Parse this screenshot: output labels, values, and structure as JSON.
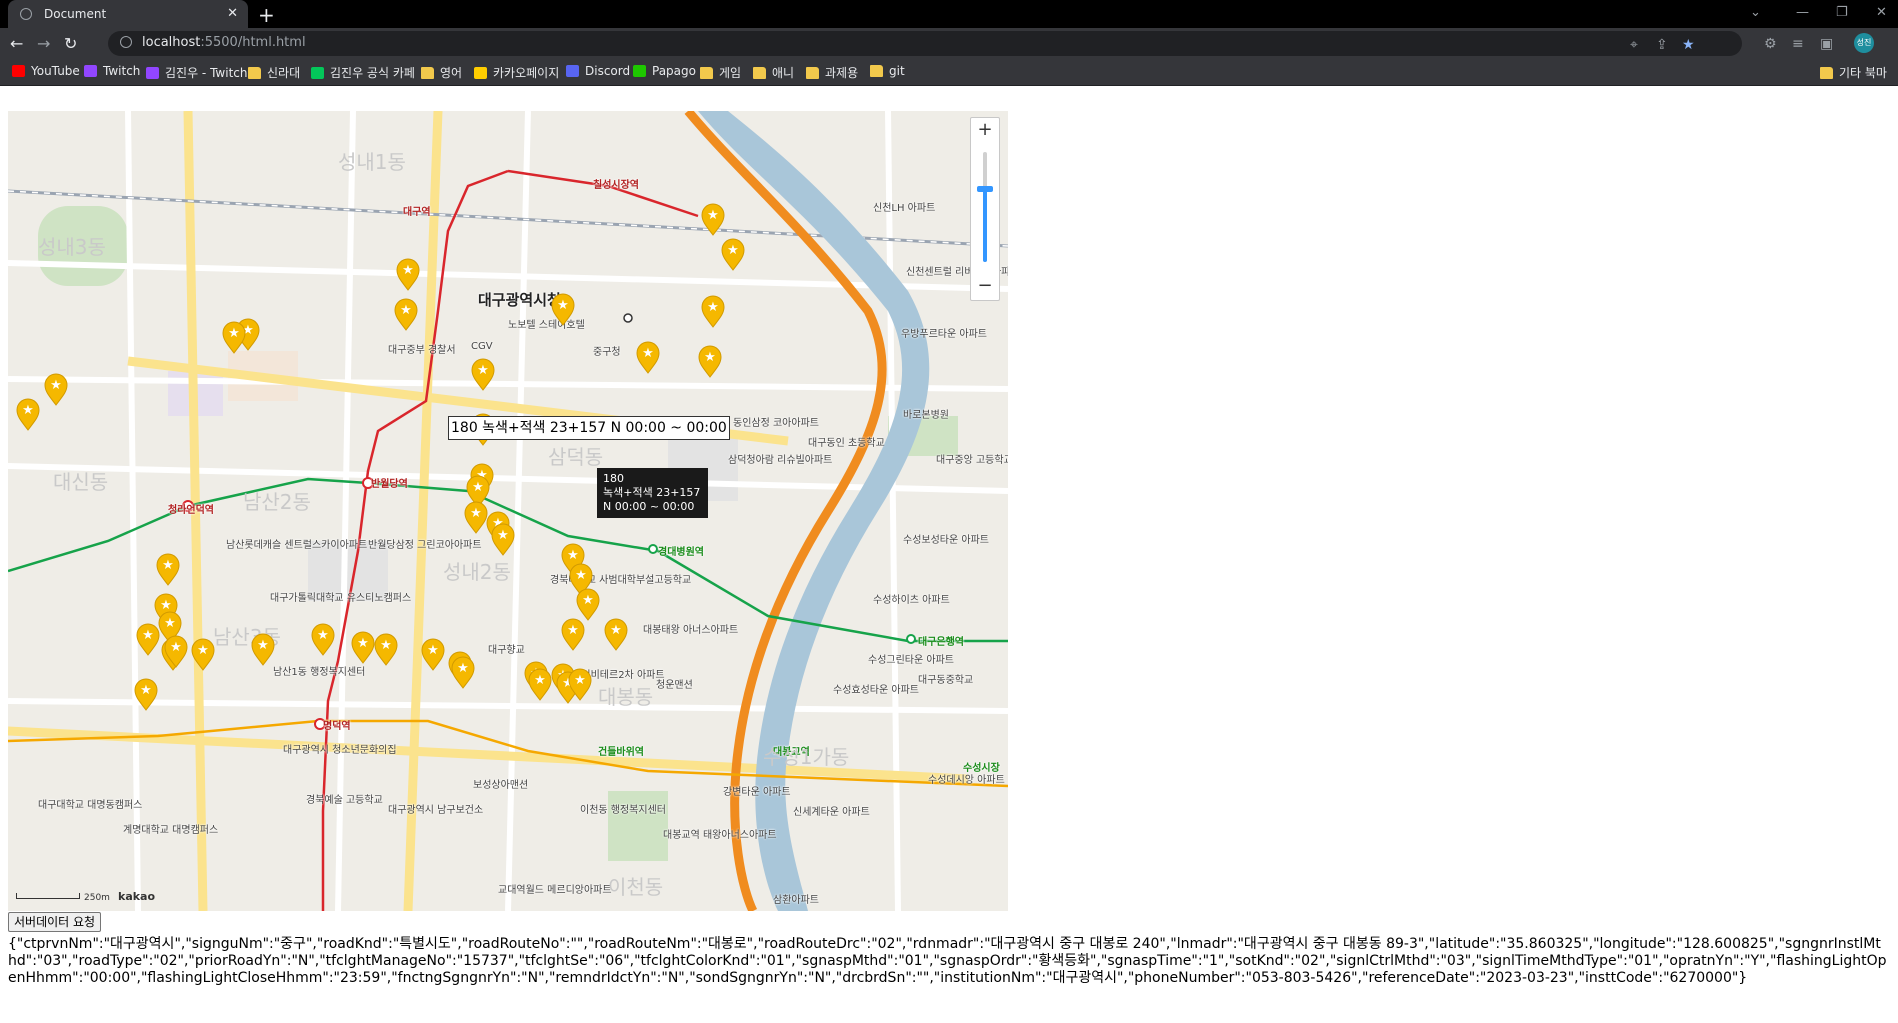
{
  "browser": {
    "tab_title": "Document",
    "url_host": "localhost",
    "url_path": ":5500/html.html",
    "avatar_text": "성진",
    "bookmarks": [
      {
        "label": "YouTube",
        "icon": "youtube-icon",
        "color": "#ff0000"
      },
      {
        "label": "Twitch",
        "icon": "twitch-icon",
        "color": "#9146ff"
      },
      {
        "label": "김진우 - Twitch",
        "icon": "twitch-icon",
        "color": "#9146ff"
      },
      {
        "label": "신라대",
        "icon": "folder-icon",
        "color": "#f2c94c"
      },
      {
        "label": "김진우 공식 카페",
        "icon": "naver-cafe-icon",
        "color": "#03c75a"
      },
      {
        "label": "영어",
        "icon": "folder-icon",
        "color": "#f2c94c"
      },
      {
        "label": "카카오페이지",
        "icon": "kakaopage-icon",
        "color": "#ffcd00"
      },
      {
        "label": "Discord",
        "icon": "discord-icon",
        "color": "#5865f2"
      },
      {
        "label": "Papago",
        "icon": "papago-icon",
        "color": "#1ec800"
      },
      {
        "label": "게임",
        "icon": "folder-icon",
        "color": "#f2c94c"
      },
      {
        "label": "애니",
        "icon": "folder-icon",
        "color": "#f2c94c"
      },
      {
        "label": "과제용",
        "icon": "folder-icon",
        "color": "#f2c94c"
      },
      {
        "label": "git",
        "icon": "folder-icon",
        "color": "#f2c94c"
      }
    ],
    "other_bookmarks": "기타 북마"
  },
  "map": {
    "zoom_in": "+",
    "zoom_out": "−",
    "scale": "250m",
    "attribution": "kakao",
    "infobox_text": "180 녹색+적색 23+157 N 00:00 ~ 00:00",
    "tooltip_lines": [
      "180",
      "녹색+적색 23+157",
      "N 00:00 ~ 00:00"
    ],
    "labels": [
      {
        "text": "대구광역시청",
        "style": "big"
      },
      {
        "text": "중구청",
        "style": ""
      },
      {
        "text": "반월당역",
        "style": "station"
      },
      {
        "text": "청라언덕역",
        "style": "station"
      },
      {
        "text": "명덕역",
        "style": "station"
      },
      {
        "text": "경대병원역",
        "style": "green"
      },
      {
        "text": "대구은행역",
        "style": "green"
      },
      {
        "text": "대구역",
        "style": "station"
      },
      {
        "text": "칠성시장역",
        "style": "station"
      },
      {
        "text": "대봉교역",
        "style": "green"
      },
      {
        "text": "건들바위역",
        "style": "green"
      },
      {
        "text": "수성시장",
        "style": "green"
      },
      {
        "text": "남산1동 행정복지센터",
        "style": ""
      },
      {
        "text": "이천동 행정복지센터",
        "style": ""
      },
      {
        "text": "대구중부 경찰서",
        "style": ""
      },
      {
        "text": "노보텔 스테이호텔",
        "style": ""
      },
      {
        "text": "CGV",
        "style": ""
      },
      {
        "text": "경북대학교 사범대학부설고등학교",
        "style": ""
      },
      {
        "text": "대봉태왕 아너스아파트",
        "style": ""
      },
      {
        "text": "더샵리비테르2차 아파트",
        "style": ""
      },
      {
        "text": "삼덕청아람 리슈빌아파트",
        "style": ""
      },
      {
        "text": "대구동인 초등학교",
        "style": ""
      },
      {
        "text": "수성보성타운 아파트",
        "style": ""
      },
      {
        "text": "수성하이츠 아파트",
        "style": ""
      },
      {
        "text": "수성그린타운 아파트",
        "style": ""
      },
      {
        "text": "대구동중학교",
        "style": ""
      },
      {
        "text": "수성효성타운 아파트",
        "style": ""
      },
      {
        "text": "신천LH 아파트",
        "style": ""
      },
      {
        "text": "신천센트럴 리버파크아파트",
        "style": ""
      },
      {
        "text": "우방푸르타운 아파트",
        "style": ""
      },
      {
        "text": "바로본병원",
        "style": ""
      },
      {
        "text": "대구중앙 고등학교",
        "style": ""
      },
      {
        "text": "동인삼정 코아아파트",
        "style": ""
      },
      {
        "text": "남산롯데캐슬 센트럴스카이아파트",
        "style": ""
      },
      {
        "text": "반월당삼정 그린코아아파트",
        "style": ""
      },
      {
        "text": "대구가톨릭대학교 유스티노캠퍼스",
        "style": ""
      },
      {
        "text": "대구광역시 청소년문화의집",
        "style": ""
      },
      {
        "text": "경북예술 고등학교",
        "style": ""
      },
      {
        "text": "대구광역시 남구보건소",
        "style": ""
      },
      {
        "text": "계명대학교 대명캠퍼스",
        "style": ""
      },
      {
        "text": "대구대학교 대명동캠퍼스",
        "style": ""
      },
      {
        "text": "보성상아맨션",
        "style": ""
      },
      {
        "text": "대봉교역 태왕아너스아파트",
        "style": ""
      },
      {
        "text": "교대역월드 메르디앙아파트",
        "style": ""
      },
      {
        "text": "대구향교",
        "style": ""
      },
      {
        "text": "청운맨션",
        "style": ""
      },
      {
        "text": "강변타운 아파트",
        "style": ""
      },
      {
        "text": "신세계타운 아파트",
        "style": ""
      },
      {
        "text": "수성데시앙 아파트",
        "style": ""
      },
      {
        "text": "삼환아파트",
        "style": ""
      },
      {
        "text": "대봉동",
        "style": "area"
      },
      {
        "text": "남산2동",
        "style": "area"
      },
      {
        "text": "남산3동",
        "style": "area"
      },
      {
        "text": "성내2동",
        "style": "area"
      },
      {
        "text": "이천동",
        "style": "area"
      },
      {
        "text": "대신동",
        "style": "area"
      },
      {
        "text": "성내3동",
        "style": "area"
      },
      {
        "text": "삼덕동",
        "style": "area"
      },
      {
        "text": "성내1동",
        "style": "area"
      },
      {
        "text": "수성1가동",
        "style": "area"
      }
    ],
    "colors": {
      "marker": "#f5b800",
      "subway_red": "#d9262c",
      "subway_green": "#16a34a",
      "river": "#a9c6d9",
      "expressway": "#f08c1f"
    }
  },
  "button": {
    "fetch_label": "서버데이터 요청"
  },
  "output": {
    "json_text": "{\"ctprvnNm\":\"대구광역시\",\"signguNm\":\"중구\",\"roadKnd\":\"특별시도\",\"roadRouteNo\":\"\",\"roadRouteNm\":\"대봉로\",\"roadRouteDrc\":\"02\",\"rdnmadr\":\"대구광역시 중구 대봉로 240\",\"lnmadr\":\"대구광역시 중구 대봉동 89-3\",\"latitude\":\"35.860325\",\"longitude\":\"128.600825\",\"sgngnrInstlMthd\":\"03\",\"roadType\":\"02\",\"priorRoadYn\":\"N\",\"tfclghtManageNo\":\"15737\",\"tfclghtSe\":\"06\",\"tfclghtColorKnd\":\"01\",\"sgnaspMthd\":\"01\",\"sgnaspOrdr\":\"황색등화\",\"sgnaspTime\":\"1\",\"sotKnd\":\"02\",\"signlCtrlMthd\":\"03\",\"signlTimeMthdType\":\"01\",\"opratnYn\":\"Y\",\"flashingLightOpenHhmm\":\"00:00\",\"flashingLightCloseHhmm\":\"23:59\",\"fnctngSgngnrYn\":\"N\",\"remndrIdctYn\":\"N\",\"sondSgngnrYn\":\"N\",\"drcbrdSn\":\"\",\"institutionNm\":\"대구광역시\",\"phoneNumber\":\"053-803-5426\",\"referenceDate\":\"2023-03-23\",\"insttCode\":\"6270000\"}"
  }
}
